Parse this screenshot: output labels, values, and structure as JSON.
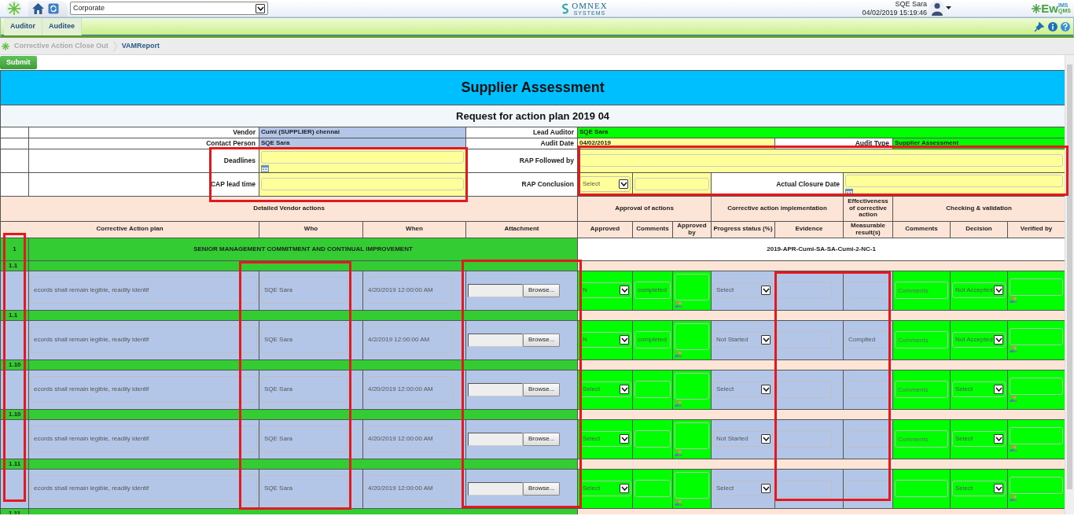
{
  "header": {
    "organization": "Corporate",
    "company_logo": {
      "name": "OMNEX",
      "tagline": "SYSTEMS"
    },
    "user": "SQE Sara",
    "datetime": "04/02/2019 15:19:46",
    "product_logo": {
      "main": "Ew",
      "upper": "IMS",
      "lower": "QMS"
    }
  },
  "tabs": [
    {
      "label": "Auditor"
    },
    {
      "label": "Auditee"
    }
  ],
  "breadcrumb": [
    {
      "label": "Corrective Action Close Out",
      "current": false
    },
    {
      "label": "VAMReport",
      "current": true
    }
  ],
  "submit_button": "Submit",
  "report": {
    "title": "Supplier Assessment",
    "subtitle": "Request for action plan 2019 04",
    "info": {
      "vendor": {
        "label": "Vendor",
        "value": "Cumi (SUPPLIER) chennai"
      },
      "contact": {
        "label": "Contact Person",
        "value": "SQE Sara"
      },
      "lead_auditor": {
        "label": "Lead Auditor",
        "value": "SQE Sara"
      },
      "audit_date": {
        "label": "Audit Date",
        "value": "04/02/2019"
      },
      "audit_type": {
        "label": "Audit Type",
        "value": "Supplier Assessment"
      },
      "deadlines": {
        "label": "Deadlines",
        "highlighted": true
      },
      "cap_lead_time": {
        "label": "CAP lead time",
        "highlighted": true
      },
      "rap_followed_by": {
        "label": "RAP Followed by",
        "highlighted": true
      },
      "rap_conclusion": {
        "label": "RAP Conclusion",
        "select": "Select",
        "highlighted": true
      },
      "actual_closure_date": {
        "label": "Actual Closure Date",
        "highlighted": true
      }
    },
    "group_headers": [
      "Detailed Vendor actions",
      "Approval of actions",
      "Corrective action implementation",
      "Effectiveness of corrective action",
      "Checking & validation"
    ],
    "number_column_highlighted": true,
    "column_headers": [
      {
        "label": "Corrective Action plan"
      },
      {
        "label": "Who",
        "highlighted": true
      },
      {
        "label": "When"
      },
      {
        "label": "Attachment",
        "highlighted": true
      },
      {
        "label": "Approved"
      },
      {
        "label": "Comments"
      },
      {
        "label": "Approved by"
      },
      {
        "label": "Progress status (%)"
      },
      {
        "label": "Evidence",
        "highlighted": true
      },
      {
        "label": "Measurable result(s)",
        "highlighted": true
      },
      {
        "label": "Comments"
      },
      {
        "label": "Decision"
      },
      {
        "label": "Verified by"
      }
    ],
    "section": {
      "number": "1",
      "title": "SENIOR MANAGEMENT COMMITMENT AND CONTINUAL IMPROVEMENT",
      "reference": "2019-APR-Cumi-SA-SA-Cumi-2-NC-1"
    },
    "items": [
      {
        "number": "1.1",
        "plan": "ecords shall remain legible, readily identif",
        "who": "SQE Sara",
        "when": "4/20/2019 12:00:00 AM",
        "browse_label": "Browse...",
        "approved": "N",
        "approval_comments": "completed",
        "progress": "Select",
        "check_comments_placeholder": "Comments",
        "decision": "Not Accepted"
      },
      {
        "number": "1.1",
        "plan": "ecords shall remain legible, readily identif",
        "who": "SQE Sara",
        "when": "4/2/2019 12:00:00 AM",
        "browse_label": "Browse...",
        "approved": "N",
        "approval_comments": "completed",
        "progress": "Not Started",
        "measurable": "Complted",
        "check_comments_placeholder": "Comments",
        "decision": "Not Accepted"
      },
      {
        "number": "1.10",
        "plan": "ecords shall remain legible, readily identif",
        "who": "SQE Sara",
        "when": "4/20/2019 12:00:00 AM",
        "browse_label": "Browse...",
        "approved": "Select",
        "progress": "Select",
        "check_comments_placeholder": "Comments",
        "decision": "Select"
      },
      {
        "number": "1.10",
        "plan": "ecords shall remain legible, readily identif",
        "who": "SQE Sara",
        "when": "4/20/2019 12:00:00 AM",
        "browse_label": "Browse...",
        "approved": "Select",
        "progress": "Not Started",
        "check_comments_placeholder": "Comments",
        "decision": "Select"
      },
      {
        "number": "1.11",
        "plan": "ecords shall remain legible, readily identif",
        "who": "SQE Sara",
        "when": "4/20/2019 12:00:00 AM",
        "browse_label": "Browse...",
        "approved": "Select",
        "progress": "Select",
        "decision": "Select"
      },
      {
        "number": "1.11"
      }
    ]
  }
}
